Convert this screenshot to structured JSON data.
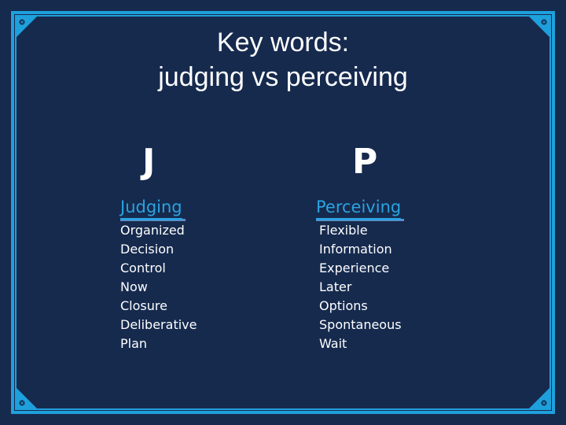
{
  "slide": {
    "title_line1": "Key words:",
    "title_line2": "judging vs perceiving",
    "colors": {
      "background": "#162a4e",
      "accent": "#1ea0dc",
      "heading": "#2aa3e0",
      "text": "#ffffff"
    }
  },
  "columns": [
    {
      "letter": "J",
      "heading": "Judging",
      "items": [
        "Organized",
        "Decision",
        "Control",
        "Now",
        "Closure",
        "Deliberative",
        "Plan"
      ]
    },
    {
      "letter": "P",
      "heading": "Perceiving",
      "items": [
        "Flexible",
        "Information",
        "Experience",
        "Later",
        "Options",
        "Spontaneous",
        "Wait"
      ]
    }
  ],
  "decor": {
    "corner_icon": "screw-icon"
  }
}
